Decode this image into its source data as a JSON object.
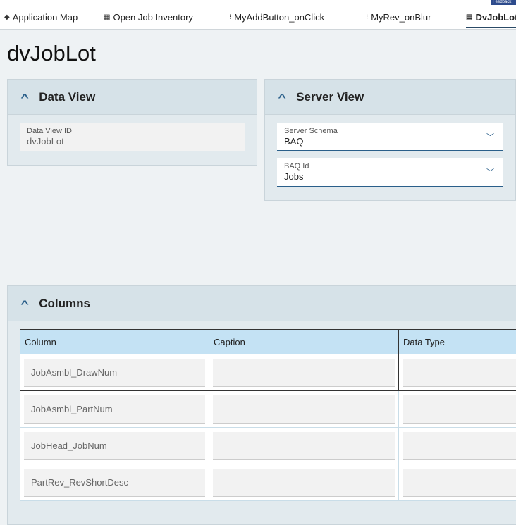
{
  "tabs": [
    {
      "label": "Application Map",
      "icon": "diamond-icon"
    },
    {
      "label": "Open Job Inventory",
      "icon": "grid-icon"
    },
    {
      "label": "MyAddButton_onClick",
      "icon": "flow-icon"
    },
    {
      "label": "MyRev_onBlur",
      "icon": "flow-icon"
    },
    {
      "label": "DvJobLot",
      "icon": "dataview-icon",
      "active": true
    }
  ],
  "feedback": "Feedback",
  "page_title": "dvJobLot",
  "data_view": {
    "title": "Data View",
    "id_label": "Data View ID",
    "id_value": "dvJobLot"
  },
  "server_view": {
    "title": "Server View",
    "schema_label": "Server Schema",
    "schema_value": "BAQ",
    "baq_label": "BAQ Id",
    "baq_value": "Jobs"
  },
  "columns": {
    "title": "Columns",
    "headers": [
      "Column",
      "Caption",
      "Data Type"
    ],
    "rows": [
      [
        "JobAsmbl_DrawNum",
        "",
        ""
      ],
      [
        "JobAsmbl_PartNum",
        "",
        ""
      ],
      [
        "JobHead_JobNum",
        "",
        ""
      ],
      [
        "PartRev_RevShortDesc",
        "",
        ""
      ]
    ]
  },
  "colors": {
    "accent": "#2a5f8a",
    "header": "#c4e2f4"
  }
}
